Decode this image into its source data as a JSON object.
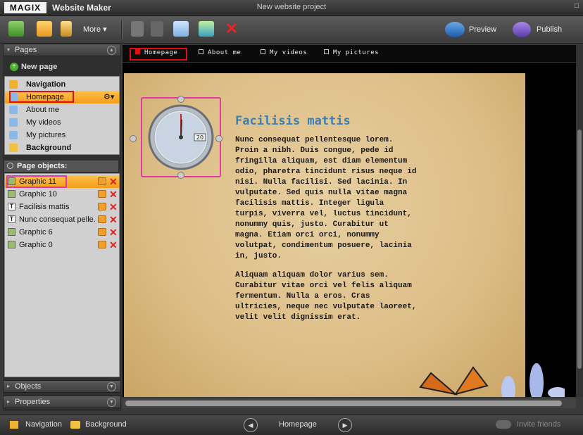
{
  "app": {
    "logo": "MAGIX",
    "name": "Website Maker",
    "project_title": "New website project",
    "window_btn": "□"
  },
  "toolbar": {
    "more_label": "More ▾",
    "preview_label": "Preview",
    "publish_label": "Publish"
  },
  "pages_panel": {
    "title": "Pages",
    "new_page": "New page",
    "items": [
      {
        "label": "Navigation",
        "bold": true
      },
      {
        "label": "Homepage",
        "selected": true
      },
      {
        "label": "About me"
      },
      {
        "label": "My videos"
      },
      {
        "label": "My pictures"
      },
      {
        "label": "Background",
        "bold": true
      }
    ]
  },
  "page_objects": {
    "title": "Page objects:",
    "items": [
      {
        "label": "Graphic 11",
        "type": "graphic",
        "selected": true
      },
      {
        "label": "Graphic 10",
        "type": "graphic"
      },
      {
        "label": "Facilisis mattis",
        "type": "text"
      },
      {
        "label": "Nunc consequat pelle...",
        "type": "text"
      },
      {
        "label": "Graphic 6",
        "type": "graphic"
      },
      {
        "label": "Graphic 0",
        "type": "graphic"
      }
    ]
  },
  "objects_panel": {
    "title": "Objects"
  },
  "properties_panel": {
    "title": "Properties"
  },
  "site_nav": [
    "Homepage",
    "About me",
    "My videos",
    "My pictures"
  ],
  "content": {
    "heading": "Facilisis mattis",
    "paragraph1": "Nunc consequat pellentesque lorem.\nProin a nibh. Duis congue, pede id\nfringilla aliquam, est diam elementum\nodio, pharetra tincidunt risus neque id\nnisi. Nulla facilisi. Sed lacinia. In\nvulputate. Sed quis nulla vitae magna\nfacilisis mattis. Integer ligula\nturpis, viverra vel, luctus tincidunt,\nnonummy quis, justo. Curabitur ut\nmagna. Etiam orci orci, nonummy\nvolutpat, condimentum posuere, lacinia\nin, justo.",
    "paragraph2": "Aliquam aliquam dolor varius sem.\nCurabitur vitae orci vel felis aliquam\nfermentum. Nulla a eros. Cras\nultricies, neque nec vulputate laoreet,\nvelit velit dignissim erat.",
    "clock_date": "20"
  },
  "bottombar": {
    "navigation": "Navigation",
    "background": "Background",
    "current_page": "Homepage",
    "invite": "Invite friends"
  },
  "colors": {
    "accent": "#f49d1a",
    "selection_pink": "#e03aa8",
    "heading_blue": "#3b7fb5"
  }
}
